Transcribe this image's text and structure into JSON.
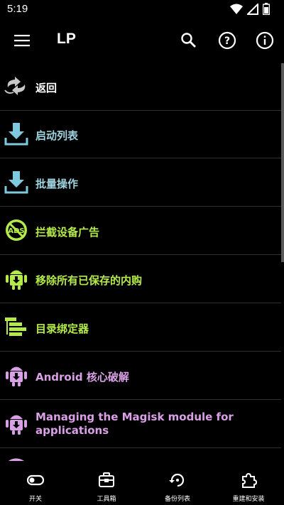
{
  "status_bar": {
    "time": "5:19"
  },
  "app_bar": {
    "title": "LP"
  },
  "colors": {
    "white": "#ffffff",
    "teal": "#9fd3e0",
    "lime": "#b4ea4a",
    "pink": "#d9a0e6",
    "icon_blue": "#7fc9df"
  },
  "list": {
    "items": [
      {
        "label": "返回",
        "icon": "back-arrows-icon",
        "color": "#ffffff"
      },
      {
        "label": "启动列表",
        "icon": "download-icon",
        "color": "#9fd3e0"
      },
      {
        "label": "批量操作",
        "icon": "download-icon",
        "color": "#9fd3e0"
      },
      {
        "label": "拦截设备广告",
        "icon": "no-ads-icon",
        "color": "#b4ea4a"
      },
      {
        "label": "移除所有已保存的内购",
        "icon": "android-download-icon",
        "color": "#b4ea4a"
      },
      {
        "label": "目录绑定器",
        "icon": "folder-tree-icon",
        "color": "#b4ea4a"
      },
      {
        "label": "Android 核心破解",
        "icon": "android-download-icon",
        "color": "#d9a0e6"
      },
      {
        "label": "Managing the Magisk module for applications",
        "icon": "android-download-icon",
        "color": "#d9a0e6"
      }
    ]
  },
  "bottom_nav": {
    "items": [
      {
        "label": "开关",
        "icon": "toggle-icon"
      },
      {
        "label": "工具箱",
        "icon": "toolbox-icon"
      },
      {
        "label": "备份列表",
        "icon": "backup-restore-icon"
      },
      {
        "label": "重建和安装",
        "icon": "puzzle-icon"
      }
    ]
  }
}
